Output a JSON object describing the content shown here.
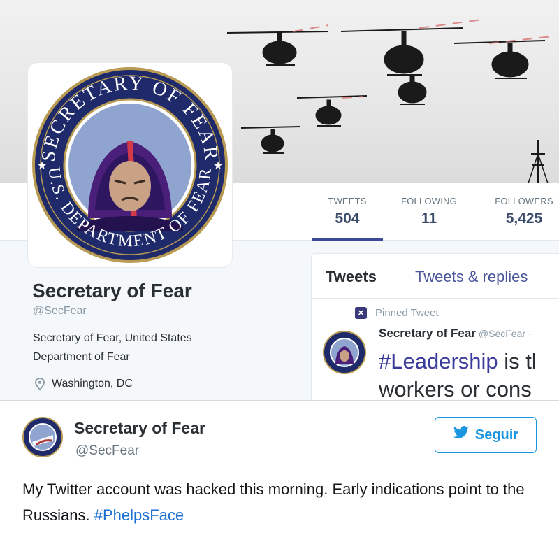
{
  "profile": {
    "name": "Secretary of Fear",
    "handle": "@SecFear",
    "bio_line1": "Secretary of Fear, United States",
    "bio_line2": "Department of Fear",
    "location": "Washington, DC",
    "seal_top_text": "SECRETARY OF FEAR",
    "seal_bottom_text": "U.S. DEPARTMENT OF FEAR"
  },
  "stats": {
    "tweets_label": "TWEETS",
    "tweets_value": "504",
    "following_label": "FOLLOWING",
    "following_value": "11",
    "followers_label": "FOLLOWERS",
    "followers_value": "5,425"
  },
  "timeline": {
    "tab_tweets": "Tweets",
    "tab_replies": "Tweets & replies",
    "pinned_label": "Pinned Tweet",
    "pinned_author": "Secretary of Fear",
    "pinned_handle": "@SecFear ·",
    "pinned_hashtag": "#Leadership",
    "pinned_text_rest": " is tl",
    "pinned_text_line2": "workers or cons"
  },
  "embed": {
    "name": "Secretary of Fear",
    "handle": "@SecFear",
    "follow_label": "Seguir",
    "text": "My Twitter account was hacked this morning. Early indications point to the Russians. ",
    "hashtag": "#PhelpsFace"
  },
  "colors": {
    "twitter_blue": "#1b95e0",
    "stat_accent": "#3b4b9a",
    "seal_navy": "#1f2a6b",
    "seal_gold": "#b89a52"
  },
  "icons": {
    "location": "map-pin-icon",
    "pinned": "pin-icon",
    "follow": "twitter-bird-icon"
  }
}
